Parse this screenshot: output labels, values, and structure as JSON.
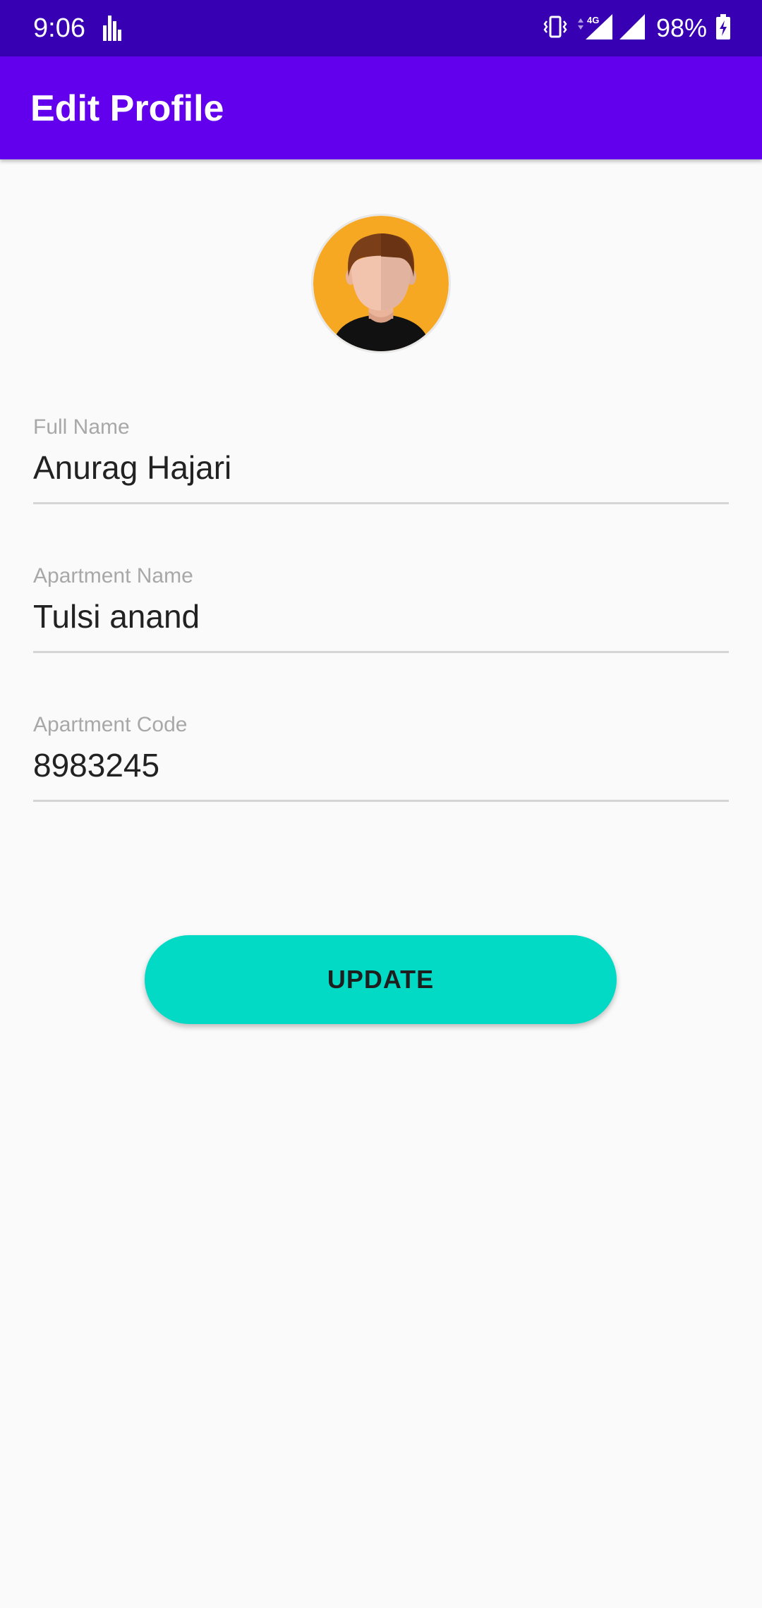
{
  "status_bar": {
    "time": "9:06",
    "network_label": "4G",
    "battery": "98%",
    "colors": {
      "background": "#3700b3"
    },
    "icons": [
      "activity-icon",
      "vibrate-icon",
      "signal-4g-icon",
      "signal-icon",
      "battery-charging-icon"
    ]
  },
  "app_bar": {
    "title": "Edit Profile",
    "color": "#6200ee"
  },
  "profile": {
    "avatar_icon": "user-avatar-icon"
  },
  "form": {
    "full_name": {
      "label": "Full Name",
      "value": "Anurag Hajari"
    },
    "apartment_name": {
      "label": "Apartment Name",
      "value": "Tulsi anand"
    },
    "apartment_code": {
      "label": "Apartment Code",
      "value": "8983245"
    }
  },
  "actions": {
    "update_label": "UPDATE",
    "update_color": "#03dac5"
  }
}
